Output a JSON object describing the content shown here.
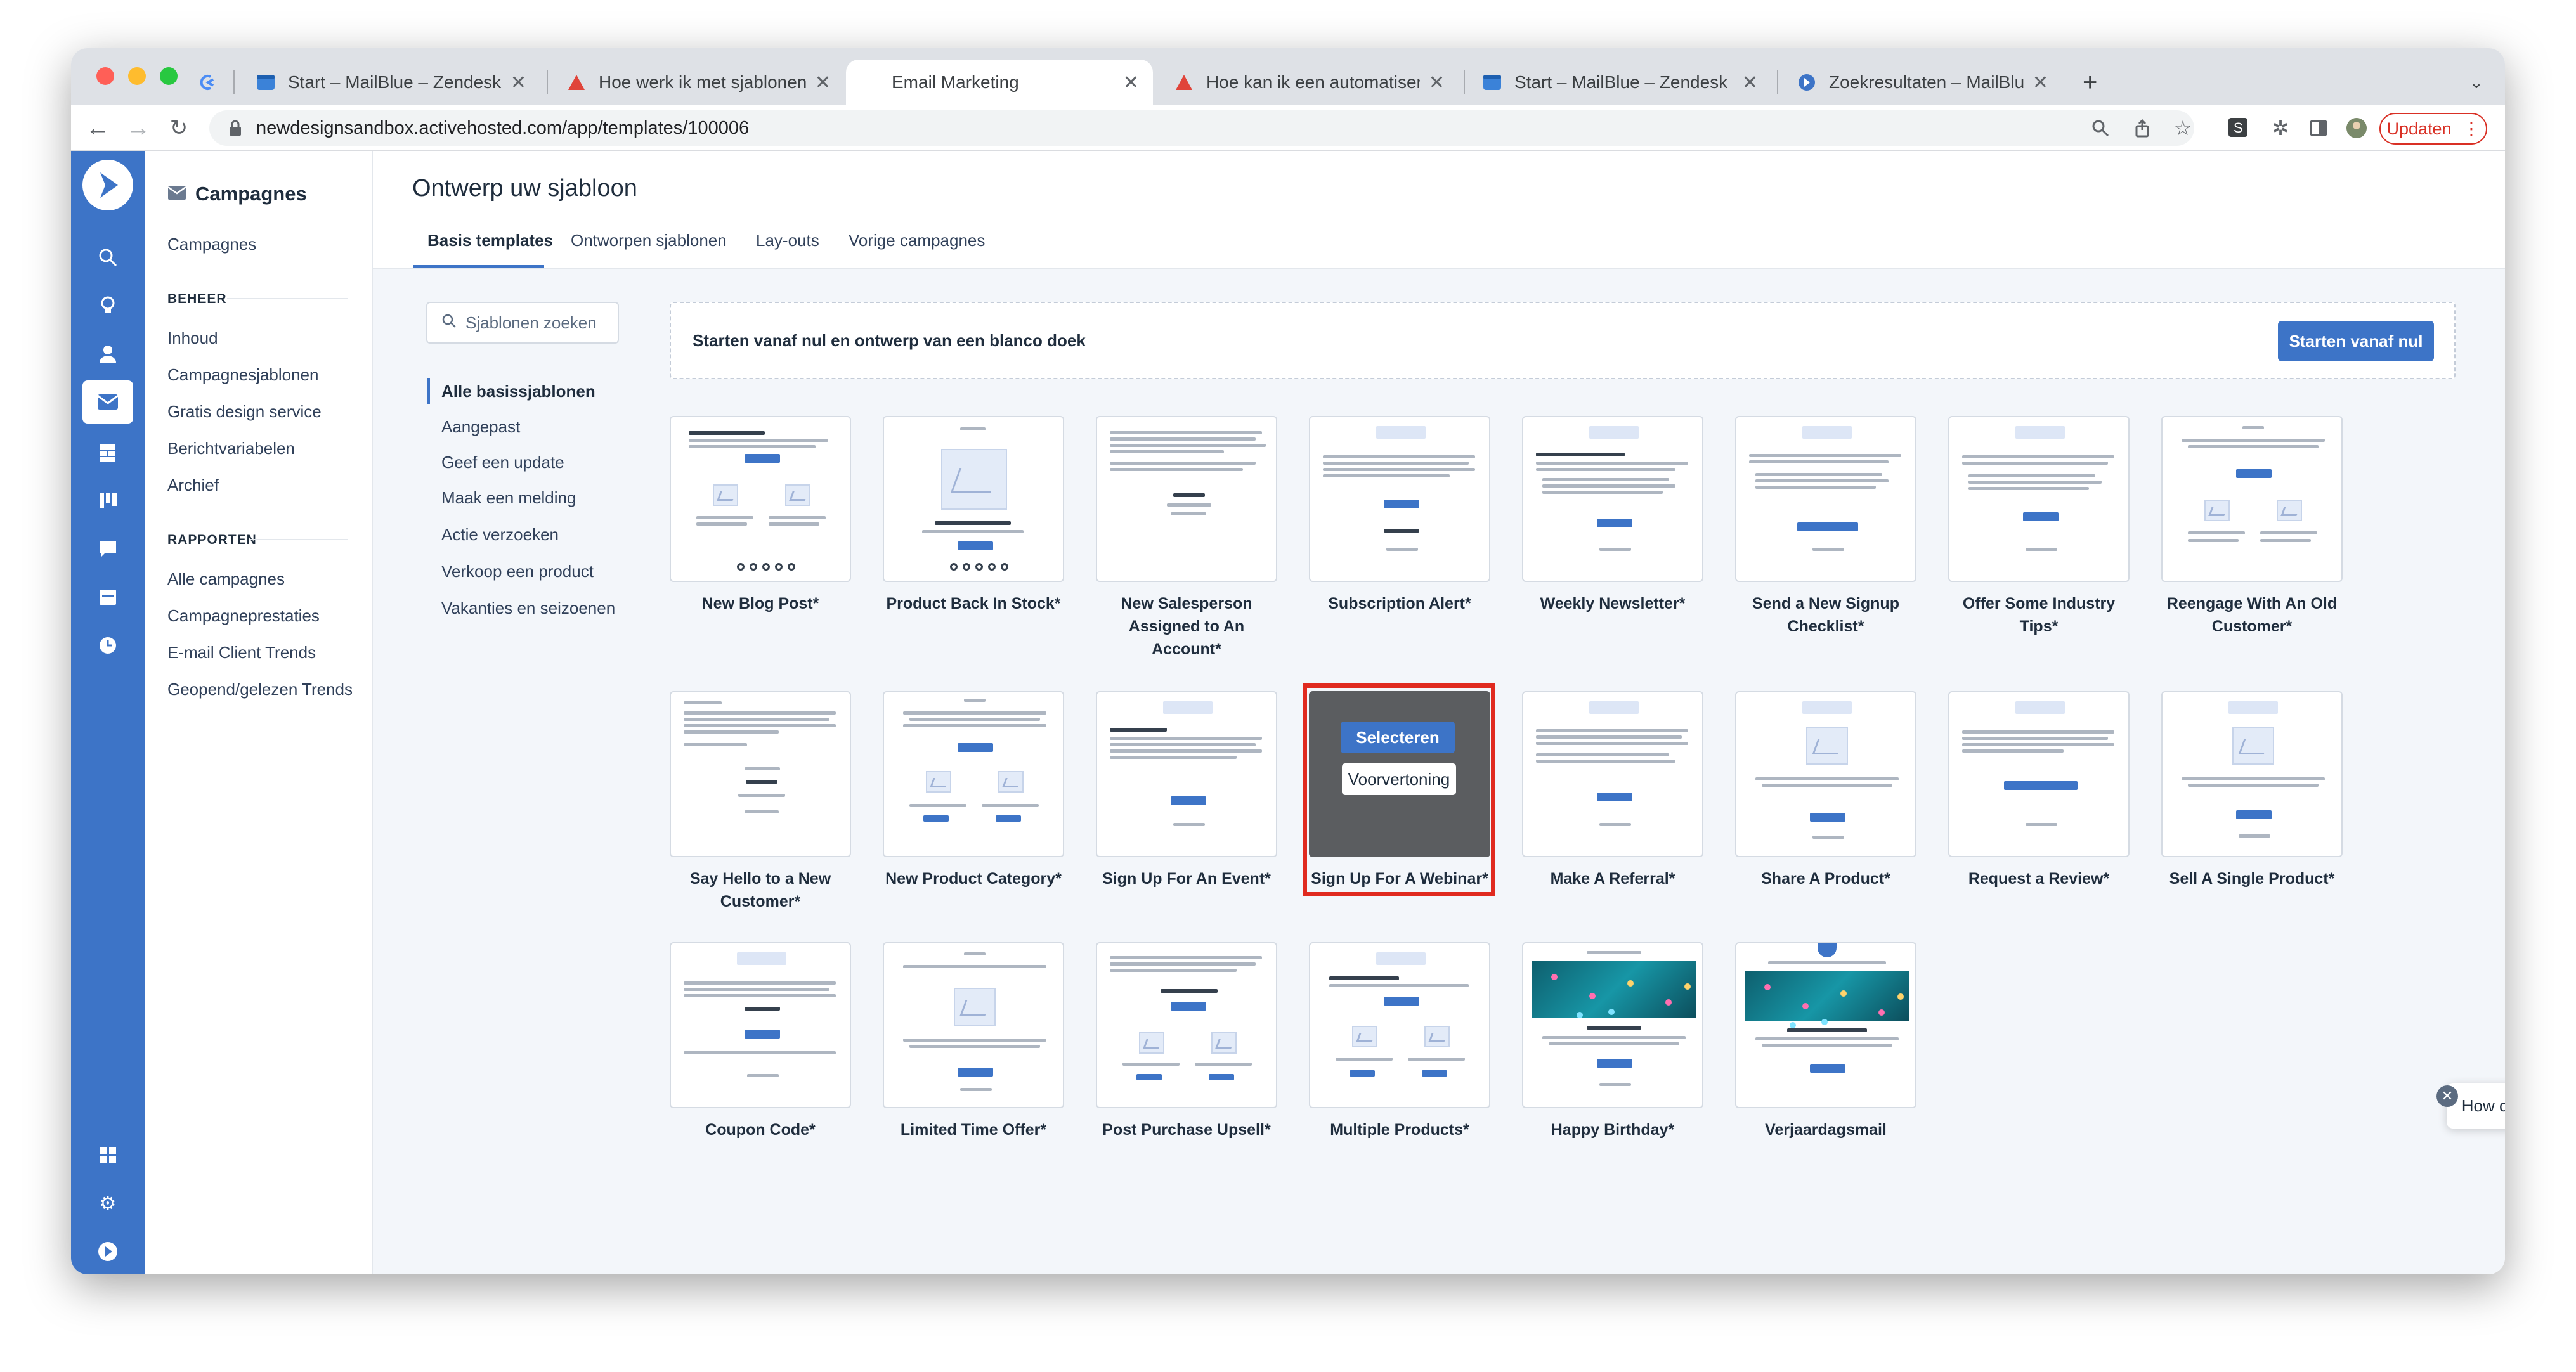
{
  "browser": {
    "tabs": [
      {
        "title": "Start – MailBlue – Zendesk",
        "icon": "zendesk-icon"
      },
      {
        "title": "Hoe werk ik met sjablonen als ...",
        "icon": "activecampaign-icon"
      },
      {
        "title": "Email Marketing",
        "icon": "none"
      },
      {
        "title": "Hoe kan ik een automatisering...",
        "icon": "activecampaign-icon"
      },
      {
        "title": "Start – MailBlue – Zendesk",
        "icon": "zendesk-icon"
      },
      {
        "title": "Zoekresultaten – MailBlue",
        "icon": "mailblue-icon"
      }
    ],
    "url": "newdesignsandbox.activehosted.com/app/templates/100006",
    "update_label": "Updaten"
  },
  "sidebar": {
    "title": "Campagnes",
    "top_item": "Campagnes",
    "beheer_header": "BEHEER",
    "beheer_items": [
      "Inhoud",
      "Campagnesjablonen",
      "Gratis design service",
      "Berichtvariabelen",
      "Archief"
    ],
    "rapporten_header": "RAPPORTEN",
    "rapporten_items": [
      "Alle campagnes",
      "Campagneprestaties",
      "E-mail Client Trends",
      "Geopend/gelezen Trends"
    ]
  },
  "main": {
    "title": "Ontwerp uw sjabloon",
    "tabs": [
      "Basis templates",
      "Ontworpen sjablonen",
      "Lay-outs",
      "Vorige campagnes"
    ],
    "search_placeholder": "Sjablonen zoeken",
    "categories": [
      "Alle basissjablonen",
      "Aangepast",
      "Geef een update",
      "Maak een melding",
      "Actie verzoeken",
      "Verkoop een product",
      "Vakanties en seizoenen"
    ],
    "blank": {
      "text": "Starten vanaf nul en ontwerp van een blanco doek",
      "button": "Starten vanaf nul"
    },
    "templates": [
      {
        "name": "New Blog Post*"
      },
      {
        "name": "Product Back In Stock*"
      },
      {
        "name": "New Salesperson Assigned to An Account*"
      },
      {
        "name": "Subscription Alert*"
      },
      {
        "name": "Weekly Newsletter*"
      },
      {
        "name": "Send a New Signup Checklist*"
      },
      {
        "name": "Offer Some Industry Tips*"
      },
      {
        "name": "Reengage With An Old Customer*"
      },
      {
        "name": "Say Hello to a New Customer*"
      },
      {
        "name": "New Product Category*"
      },
      {
        "name": "Sign Up For An Event*"
      },
      {
        "name": "Sign Up For A Webinar*"
      },
      {
        "name": "Make A Referral*"
      },
      {
        "name": "Share A Product*"
      },
      {
        "name": "Request a Review*"
      },
      {
        "name": "Sell A Single Product*"
      },
      {
        "name": "Coupon Code*"
      },
      {
        "name": "Limited Time Offer*"
      },
      {
        "name": "Post Purchase Upsell*"
      },
      {
        "name": "Multiple Products*"
      },
      {
        "name": "Happy Birthday*"
      },
      {
        "name": "Verjaardagsmail"
      }
    ],
    "hover": {
      "select": "Selecteren",
      "preview": "Voorvertoning"
    }
  },
  "chat": {
    "prompt": "How can we help you today?"
  },
  "colors": {
    "accent": "#3d74c7",
    "highlight": "#e02a1f"
  }
}
